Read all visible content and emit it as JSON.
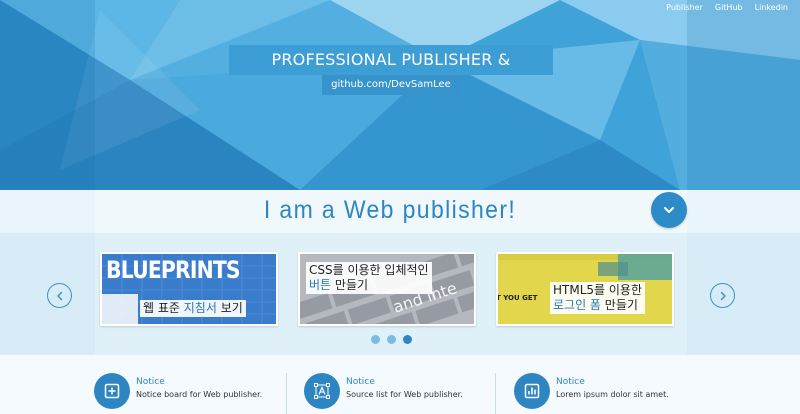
{
  "nav": {
    "items": [
      "Publisher",
      "GitHub",
      "Linkedin"
    ]
  },
  "hero": {
    "title": "PROFESSIONAL PUBLISHER & DESIGNER",
    "subtitle": "github.com/DevSamLee"
  },
  "headline": {
    "text": "I am a Web publisher!"
  },
  "carousel": {
    "cards": [
      {
        "image_text": "BLUEPRINTS",
        "caption_plain": "웹 표준 ",
        "caption_highlight": "지침서",
        "caption_tail": " 보기"
      },
      {
        "image_text": "and inte",
        "caption_line1": "CSS를 이용한 입체적인",
        "caption_highlight": "버튼",
        "caption_tail": " 만들기"
      },
      {
        "image_text": "T YOU GET",
        "caption_line1": "HTML5를 이용한",
        "caption_highlight": "로그인 폼",
        "caption_tail": " 만들기"
      }
    ],
    "active_dot": 3
  },
  "notices": [
    {
      "title": "Notice",
      "description": "Notice board for Web publisher.",
      "icon": "add-box-icon"
    },
    {
      "title": "Notice",
      "description": "Source list for Web publisher.",
      "icon": "vector-a-icon"
    },
    {
      "title": "Notice",
      "description": "Lorem ipsum dolor sit amet.",
      "icon": "bar-chart-icon"
    }
  ],
  "colors": {
    "primary": "#2d86c2",
    "hero": "#3a9bd3",
    "band": "#e9f5fb"
  }
}
